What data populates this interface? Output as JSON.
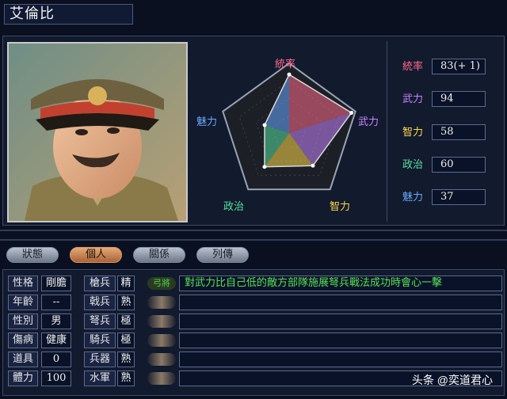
{
  "general": {
    "name": "艾倫比"
  },
  "radar": {
    "labels": {
      "leadership": "統率",
      "war": "武力",
      "intelligence": "智力",
      "politics": "政治",
      "charm": "魅力"
    },
    "max": 100
  },
  "stats": [
    {
      "key": "leadership",
      "label": "統率",
      "value": "83(+ 1)",
      "raw": 84,
      "color": "#ff6b8a"
    },
    {
      "key": "war",
      "label": "武力",
      "value": "94",
      "raw": 94,
      "color": "#c985ff"
    },
    {
      "key": "intelligence",
      "label": "智力",
      "value": "58",
      "raw": 58,
      "color": "#ffd84a"
    },
    {
      "key": "politics",
      "label": "政治",
      "value": "60",
      "raw": 60,
      "color": "#58e0a0"
    },
    {
      "key": "charm",
      "label": "魅力",
      "value": "37",
      "raw": 37,
      "color": "#6aa8ff"
    }
  ],
  "tabs": [
    {
      "label": "狀態",
      "active": false
    },
    {
      "label": "個人",
      "active": true
    },
    {
      "label": "關係",
      "active": false
    },
    {
      "label": "列傳",
      "active": false
    }
  ],
  "info": [
    {
      "label": "性格",
      "value": "剛膽"
    },
    {
      "label": "年齡",
      "value": "--"
    },
    {
      "label": "性別",
      "value": "男"
    },
    {
      "label": "傷病",
      "value": "健康"
    },
    {
      "label": "道具",
      "value": "0"
    },
    {
      "label": "體力",
      "value": "100"
    }
  ],
  "aptitudes": [
    {
      "label": "槍兵",
      "grade": "精"
    },
    {
      "label": "戟兵",
      "grade": "熟"
    },
    {
      "label": "弩兵",
      "grade": "極"
    },
    {
      "label": "騎兵",
      "grade": "極"
    },
    {
      "label": "兵器",
      "grade": "熟"
    },
    {
      "label": "水軍",
      "grade": "熟"
    }
  ],
  "traits": [
    {
      "tag": "弓將",
      "text": "對武力比自己低的敵方部隊施展弩兵戰法成功時會心一擊",
      "active": true
    },
    {
      "tag": "",
      "text": "",
      "active": false
    },
    {
      "tag": "",
      "text": "",
      "active": false
    },
    {
      "tag": "",
      "text": "",
      "active": false
    },
    {
      "tag": "",
      "text": "",
      "active": false
    },
    {
      "tag": "",
      "text": "",
      "active": false
    }
  ],
  "watermark": "头条 @奕道君心"
}
